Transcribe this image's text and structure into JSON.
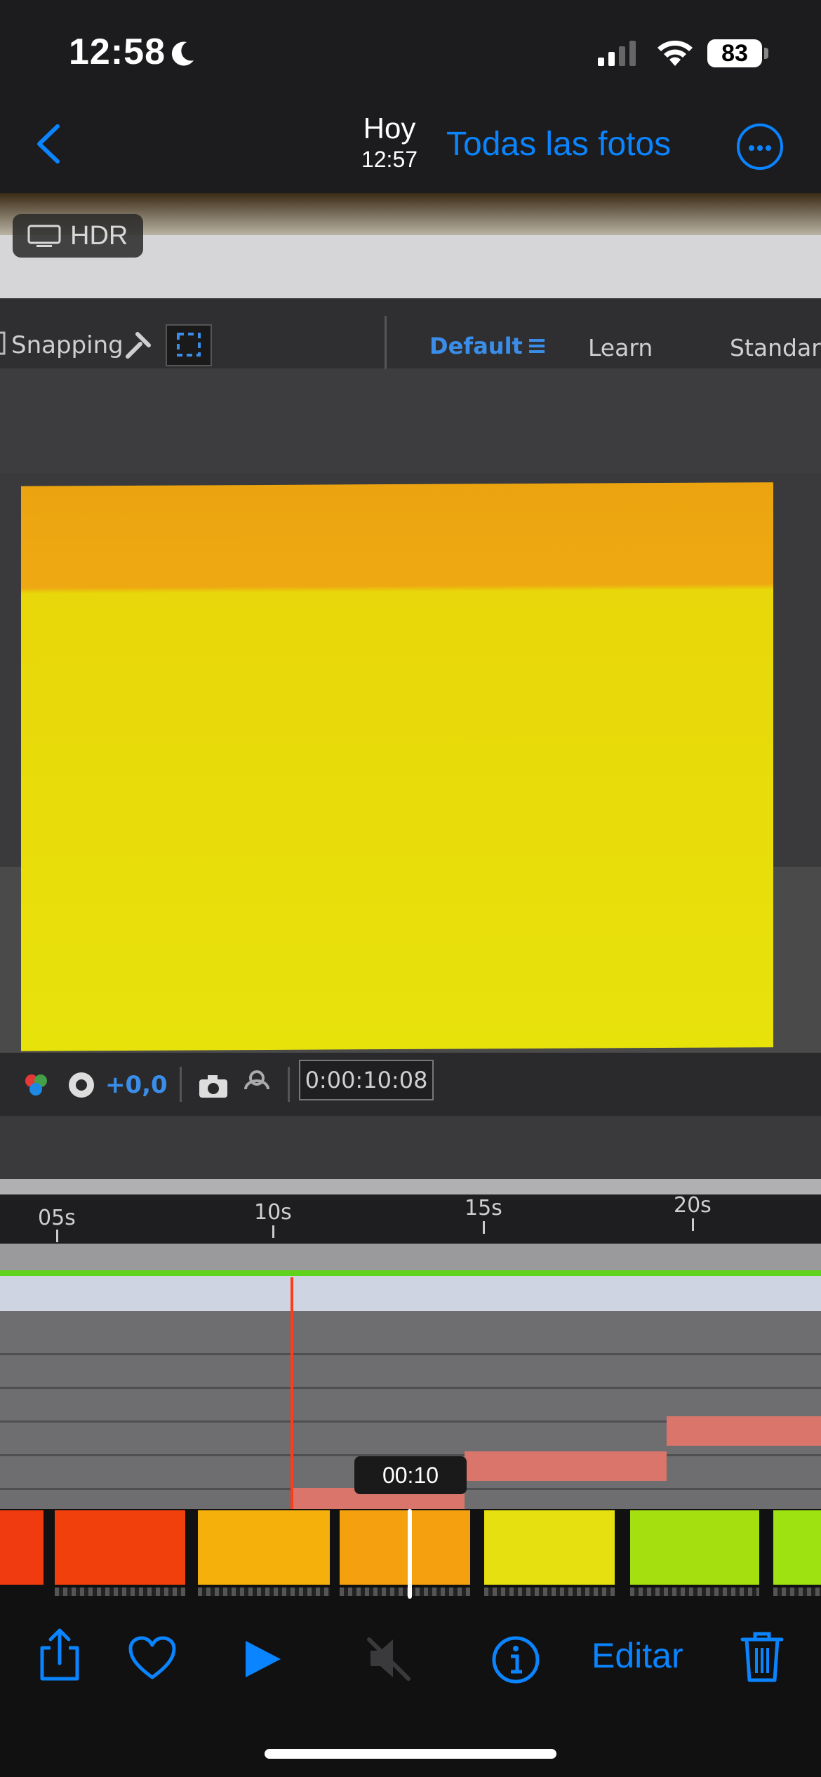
{
  "status_bar": {
    "time": "12:58",
    "battery": "83"
  },
  "nav": {
    "title": "Hoy",
    "subtitle": "12:57",
    "all_photos": "Todas las fotos"
  },
  "hdr_badge": "HDR",
  "photo_content": {
    "snapping_label": "Snapping",
    "workspace_default": "Default",
    "workspace_learn": "Learn",
    "workspace_standard": "Standard",
    "exposure_value": "+0,0",
    "timecode": "0:00:10:08",
    "ruler_ticks": [
      "05s",
      "10s",
      "15s",
      "20s"
    ]
  },
  "scrubber": {
    "time": "00:10"
  },
  "toolbar": {
    "edit_label": "Editar"
  },
  "colors": {
    "accent": "#0a84ff",
    "playhead": "#ff3b1a",
    "layer_bar": "#d9756a",
    "canvas_yellow": "#e8e20b"
  },
  "icons": [
    "back-icon",
    "more-icon",
    "share-icon",
    "heart-icon",
    "play-icon",
    "mute-icon",
    "info-icon",
    "trash-icon"
  ]
}
